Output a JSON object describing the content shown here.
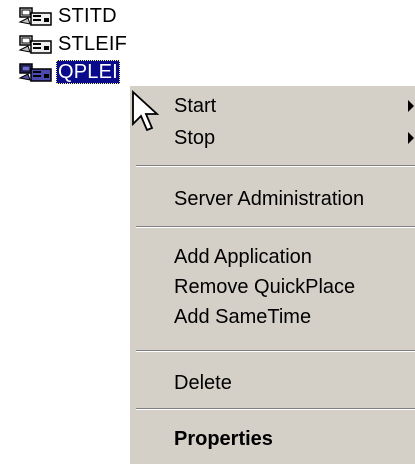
{
  "tree": {
    "items": [
      {
        "label": "STITD",
        "icon": "server-computer-icon",
        "selected": false
      },
      {
        "label": "STLEIF",
        "icon": "server-computer-icon",
        "selected": false
      },
      {
        "label": "QPLEI",
        "icon": "server-computer-icon",
        "selected": true
      }
    ]
  },
  "context_menu": {
    "items": [
      {
        "label": "Start",
        "has_submenu": true
      },
      {
        "label": "Stop",
        "has_submenu": true
      },
      {
        "label": "Server Administration",
        "has_submenu": false
      },
      {
        "label": "Add Application",
        "has_submenu": false
      },
      {
        "label": "Remove QuickPlace",
        "has_submenu": false
      },
      {
        "label": "Add SameTime",
        "has_submenu": false
      },
      {
        "label": "Delete",
        "has_submenu": false
      },
      {
        "label": "Properties",
        "has_submenu": false,
        "bold": true
      }
    ]
  },
  "colors": {
    "menu_bg": "#d4d0c8",
    "selection_bg": "#0a0a8c",
    "selection_text": "#ffffff",
    "separator_dark": "#808080"
  }
}
